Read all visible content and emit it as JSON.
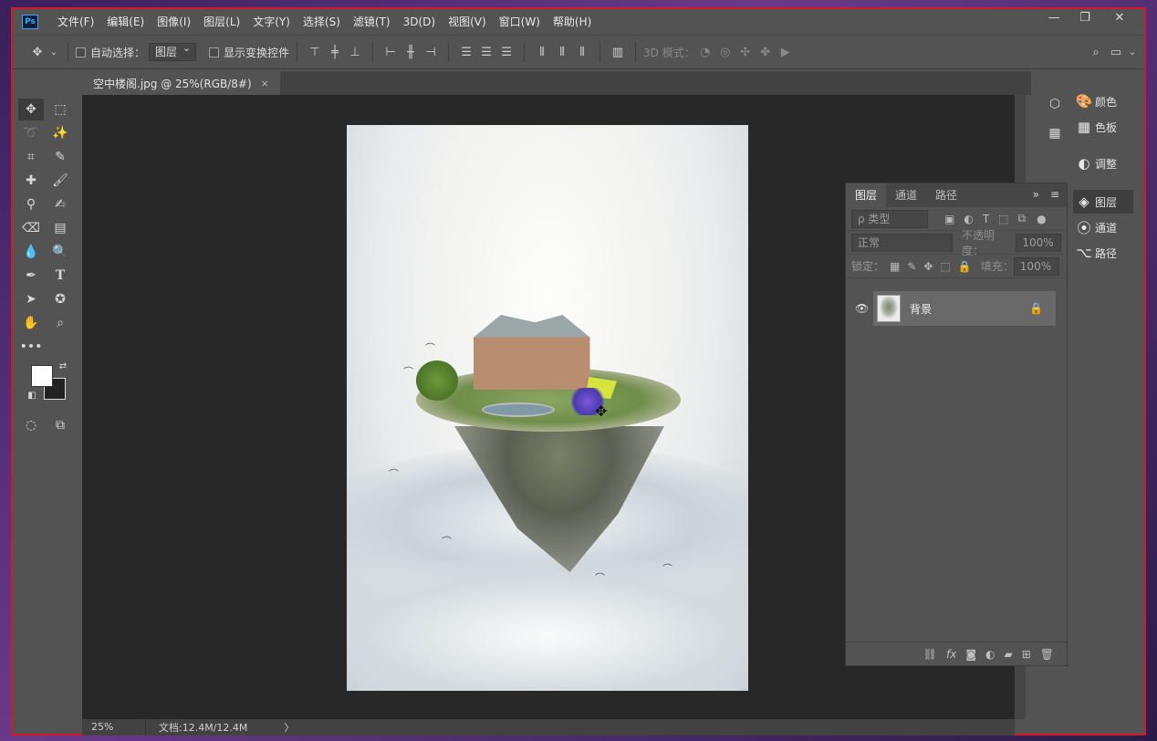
{
  "menu": [
    "文件(F)",
    "编辑(E)",
    "图像(I)",
    "图层(L)",
    "文字(Y)",
    "选择(S)",
    "滤镜(T)",
    "3D(D)",
    "视图(V)",
    "窗口(W)",
    "帮助(H)"
  ],
  "app_logo": "Ps",
  "window_controls": {
    "minimize": "—",
    "restore": "❐",
    "close": "✕"
  },
  "options": {
    "auto_select_label": "自动选择：",
    "auto_select_value": "图层",
    "show_transform_label": "显示变换控件",
    "mode_3d_label": "3D 模式："
  },
  "document_tab": {
    "title": "空中楼阁.jpg @ 25%(RGB/8#)",
    "close": "×"
  },
  "status": {
    "zoom": "25%",
    "doc_size": "文档:12.4M/12.4M",
    "arrow": "〉"
  },
  "right_panels": [
    {
      "label": "颜色",
      "icon": "palette-icon"
    },
    {
      "label": "色板",
      "icon": "swatches-icon"
    },
    {
      "label": "调整",
      "icon": "adjustments-icon"
    },
    {
      "label": "图层",
      "icon": "layers-icon"
    },
    {
      "label": "通道",
      "icon": "channels-icon"
    },
    {
      "label": "路径",
      "icon": "paths-icon"
    }
  ],
  "layers_panel": {
    "tabs": [
      "图层",
      "通道",
      "路径"
    ],
    "filter_placeholder": "ρ 类型",
    "blend_mode": "正常",
    "opacity_label": "不透明度：",
    "opacity_value": "100%",
    "lock_label": "锁定：",
    "fill_label": "填充：",
    "fill_value": "100%",
    "layer_name": "背景"
  },
  "colors": {
    "accent_border": "#d3182a",
    "panel": "#535353",
    "canvas_bg": "#282828"
  }
}
